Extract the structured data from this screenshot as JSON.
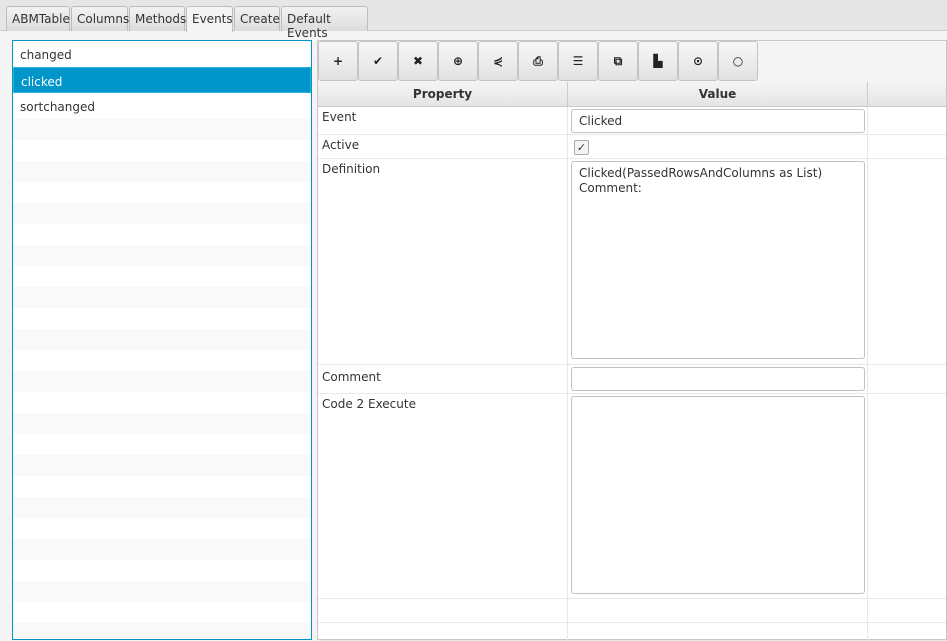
{
  "tabs": [
    "ABMTable",
    "Columns",
    "Methods",
    "Events",
    "Create",
    "Default Events"
  ],
  "active_tab": "Events",
  "events": [
    "changed",
    "clicked",
    "sortchanged"
  ],
  "selected_event": "clicked",
  "toolbar": [
    "plus-icon",
    "check-icon",
    "times-icon",
    "plus-circle-icon",
    "share-icon",
    "print-icon",
    "list-icon",
    "copy-icon",
    "paste-icon",
    "dot-circle-icon",
    "circle-icon"
  ],
  "toolbar_glyphs": [
    "+",
    "✔",
    "✖",
    "⊕",
    "⋞",
    "⎙",
    "☰",
    "⧉",
    "▙",
    "⊙",
    "○"
  ],
  "grid": {
    "headers": [
      "Property",
      "Value"
    ],
    "event_label": "Event",
    "event_value": "Clicked",
    "active_label": "Active",
    "active_checked": true,
    "check_glyph": "✓",
    "definition_label": "Definition",
    "definition_value": "Clicked(PassedRowsAndColumns as List)\nComment:",
    "comment_label": "Comment",
    "comment_value": "",
    "code_label": "Code 2 Execute",
    "code_value": ""
  }
}
